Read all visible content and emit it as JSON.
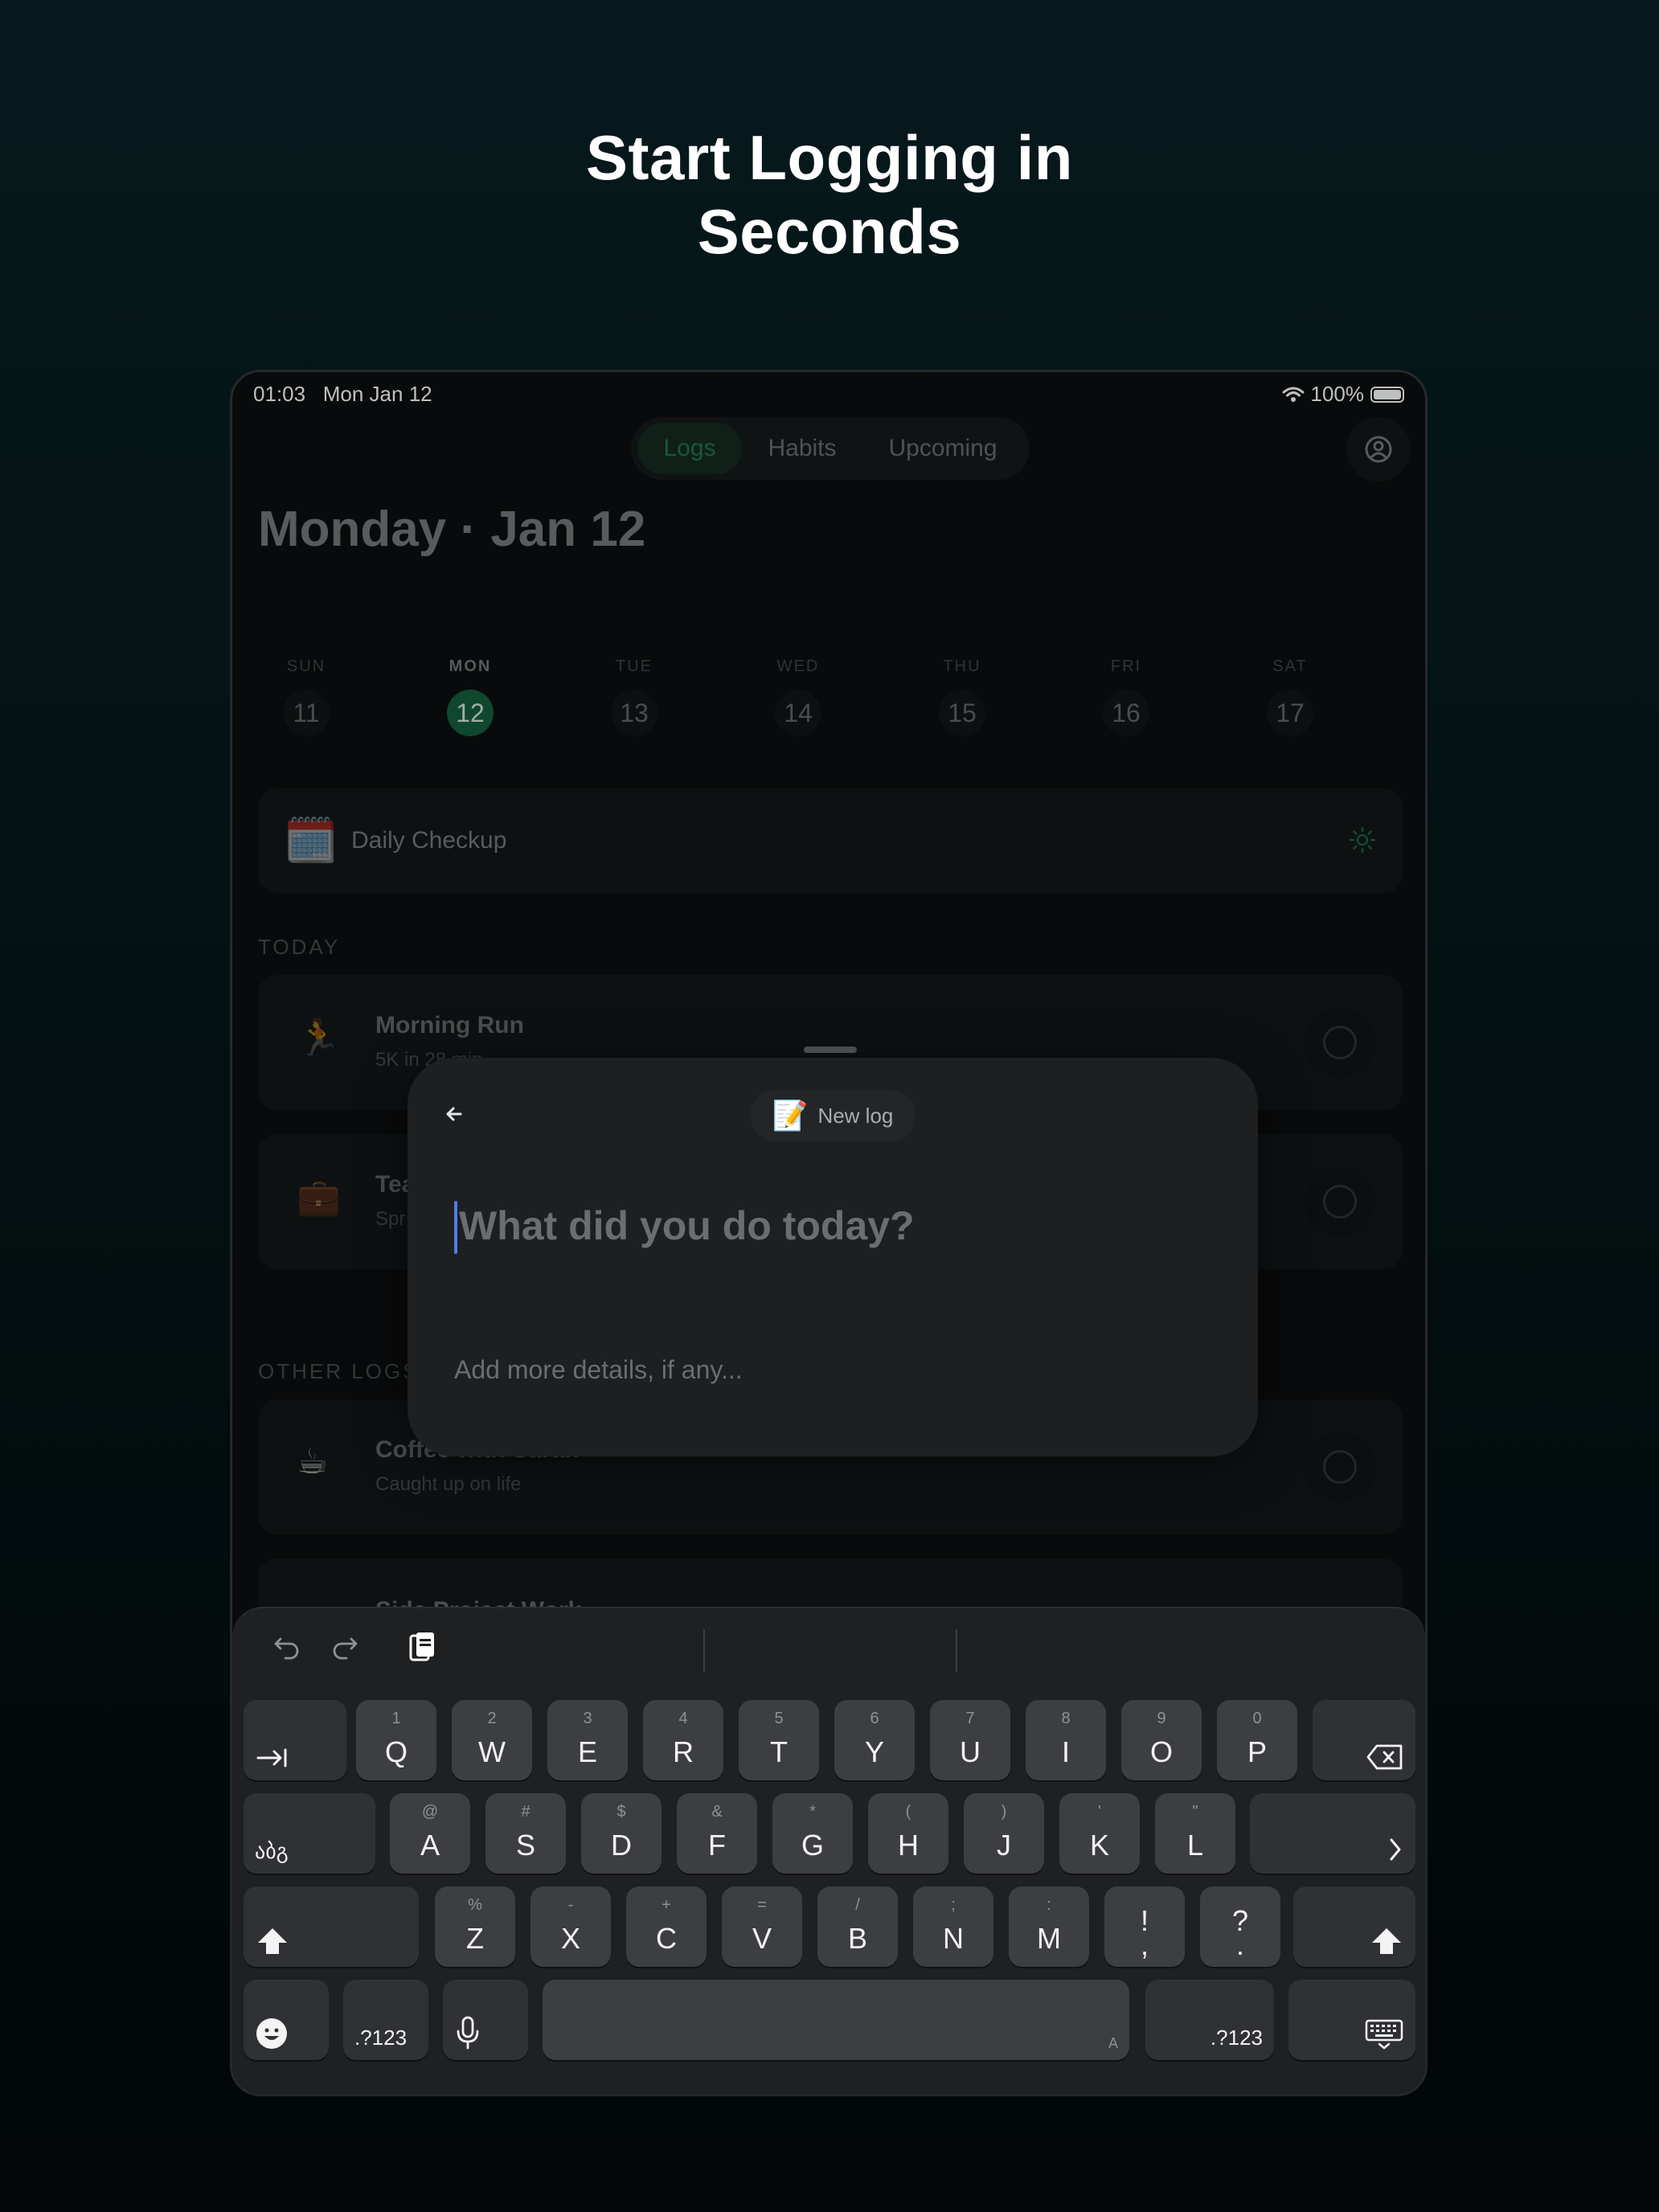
{
  "headline": {
    "line1": "Start Logging in",
    "line2": "Seconds"
  },
  "status": {
    "time": "01:03",
    "date": "Mon Jan 12",
    "battery": "100%"
  },
  "tabs": [
    {
      "label": "Logs",
      "active": true
    },
    {
      "label": "Habits",
      "active": false
    },
    {
      "label": "Upcoming",
      "active": false
    }
  ],
  "page": {
    "title": "Monday · Jan 12"
  },
  "week": [
    {
      "name": "SUN",
      "date": "11",
      "active": false
    },
    {
      "name": "MON",
      "date": "12",
      "active": true
    },
    {
      "name": "TUE",
      "date": "13",
      "active": false
    },
    {
      "name": "WED",
      "date": "14",
      "active": false
    },
    {
      "name": "THU",
      "date": "15",
      "active": false
    },
    {
      "name": "FRI",
      "date": "16",
      "active": false
    },
    {
      "name": "SAT",
      "date": "17",
      "active": false
    }
  ],
  "checkup": {
    "emoji": "🗓️",
    "label": "Daily Checkup"
  },
  "sections": {
    "today": "TODAY",
    "other": "OTHER LOGS"
  },
  "logs": {
    "today": [
      {
        "emoji": "🏃",
        "title": "Morning Run",
        "subtitle": "5K in 28 min"
      },
      {
        "emoji": "💼",
        "title": "Tea",
        "subtitle": "Spr"
      }
    ],
    "other": [
      {
        "emoji": "☕",
        "title": "Coffee with Sarah",
        "subtitle": "Caught up on life"
      },
      {
        "emoji": "",
        "title": "Side Project Work",
        "subtitle": ""
      }
    ]
  },
  "sheet": {
    "pill_emoji": "📝",
    "pill_label": "New log",
    "title_placeholder": "What did you do today?",
    "details_placeholder": "Add more details, if any..."
  },
  "keyboard": {
    "row1": [
      {
        "main": "Q",
        "hint": "1"
      },
      {
        "main": "W",
        "hint": "2"
      },
      {
        "main": "E",
        "hint": "3"
      },
      {
        "main": "R",
        "hint": "4"
      },
      {
        "main": "T",
        "hint": "5"
      },
      {
        "main": "Y",
        "hint": "6"
      },
      {
        "main": "U",
        "hint": "7"
      },
      {
        "main": "I",
        "hint": "8"
      },
      {
        "main": "O",
        "hint": "9"
      },
      {
        "main": "P",
        "hint": "0"
      }
    ],
    "row2": [
      {
        "main": "A",
        "hint": "@"
      },
      {
        "main": "S",
        "hint": "#"
      },
      {
        "main": "D",
        "hint": "$"
      },
      {
        "main": "F",
        "hint": "&"
      },
      {
        "main": "G",
        "hint": "*"
      },
      {
        "main": "H",
        "hint": "("
      },
      {
        "main": "J",
        "hint": ")"
      },
      {
        "main": "K",
        "hint": "'"
      },
      {
        "main": "L",
        "hint": "\""
      }
    ],
    "row3": [
      {
        "main": "Z",
        "hint": "%"
      },
      {
        "main": "X",
        "hint": "-"
      },
      {
        "main": "C",
        "hint": "+"
      },
      {
        "main": "V",
        "hint": "="
      },
      {
        "main": "B",
        "hint": "/"
      },
      {
        "main": "N",
        "hint": ";"
      },
      {
        "main": "M",
        "hint": ":"
      }
    ],
    "punct": [
      {
        "top": "!",
        "bottom": ","
      },
      {
        "top": "?",
        "bottom": "."
      }
    ],
    "lang_label": "აბგ",
    "numbers_label": ".?123",
    "space_mark": "A"
  }
}
